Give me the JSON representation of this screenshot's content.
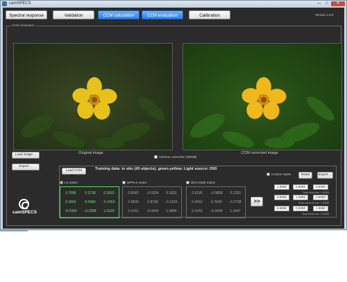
{
  "window": {
    "title": "camSPECS",
    "min_glyph": "—",
    "max_glyph": "□",
    "close_glyph": "✕"
  },
  "tabs": [
    {
      "label": "Spectral response",
      "active": false
    },
    {
      "label": "Validation",
      "active": false
    },
    {
      "label": "CCM calculation",
      "active": false
    },
    {
      "label": "CCM evaluation",
      "active": true
    },
    {
      "label": "Calibration",
      "active": false
    }
  ],
  "version": "Version 1.0.0",
  "group_label": "CCM evaluation",
  "images": {
    "original_caption": "Original image",
    "corrected_caption": "CCM corrected image",
    "gamma_label": "Gamma correction (sRGB)"
  },
  "buttons": {
    "load_image": "Load image ...",
    "export_left": "Export ...",
    "load_ccm": "Load CCM file...",
    "reset": "Reset",
    "export_right": "Export ...",
    "arrow": ">>"
  },
  "training_text": "Training data: in situ (43 objects), green-yellow; Light source: D50",
  "logo_text": "camSPECS",
  "matrices": [
    {
      "label": "LS matrix",
      "selected": true,
      "rows": [
        [
          "0.7688",
          "0.2738",
          "0.2652"
        ],
        [
          "0.2854",
          "0.0980",
          "-0.2450"
        ],
        [
          "-0.0390",
          "-0.2588",
          "1.0183"
        ]
      ]
    },
    {
      "label": "WPPLS matrix",
      "selected": false,
      "rows": [
        [
          "0.8342",
          "-0.0334",
          "0.1831"
        ],
        [
          "0.0830",
          "0.8799",
          "-0.1629"
        ],
        [
          "0.1041",
          "-0.4340",
          "1.0884"
        ]
      ]
    },
    {
      "label": "DECAMSE matrix",
      "selected": false,
      "rows": [
        [
          "0.9195",
          "-0.0808",
          "0.1250"
        ],
        [
          "0.4252",
          "0.7606",
          "-0.2738"
        ],
        [
          "0.1042",
          "-0.4438",
          "1.3447"
        ]
      ]
    }
  ],
  "custom": {
    "label": "Custom matrix",
    "rows": [
      [
        "1.0000",
        "0.0000",
        "0.0000"
      ],
      [
        "0.0000",
        "1.0000",
        "0.0000"
      ],
      [
        "0.0000",
        "0.0000",
        "1.0000"
      ]
    ],
    "sums": [
      "Sum first row: 1.0000",
      "Sum second row: 1.0000",
      "Sum third row: 1.0000"
    ]
  }
}
